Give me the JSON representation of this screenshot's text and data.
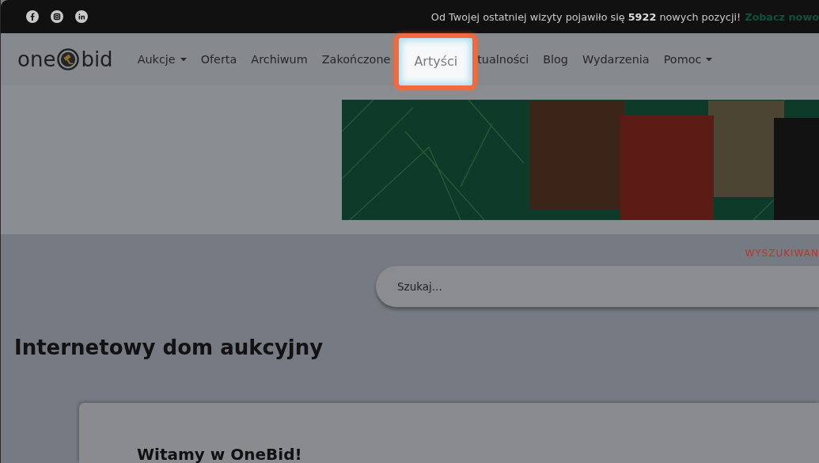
{
  "top_bar": {
    "announcement": "Od Twojej ostatniej wizyty pojawiło się **5922** nowych pozycji!",
    "announcement_link": "Zobacz nowo"
  },
  "logo": {
    "text_left": "one",
    "text_right": "bid"
  },
  "nav": {
    "items": [
      {
        "label": "Aukcje",
        "has_menu": true,
        "highlighted": false
      },
      {
        "label": "Oferta",
        "has_menu": false,
        "highlighted": false
      },
      {
        "label": "Archiwum",
        "has_menu": false,
        "highlighted": false
      },
      {
        "label": "Zakończone",
        "has_menu": false,
        "highlighted": false
      },
      {
        "label": "Artyści",
        "has_menu": false,
        "highlighted": true
      },
      {
        "label": "tualności",
        "has_menu": false,
        "highlighted": false
      },
      {
        "label": "Blog",
        "has_menu": false,
        "highlighted": false
      },
      {
        "label": "Wydarzenia",
        "has_menu": false,
        "highlighted": false
      },
      {
        "label": "Pomoc",
        "has_menu": true,
        "highlighted": false
      }
    ]
  },
  "search": {
    "link": "WYSZUKIWAN",
    "placeholder": "Szukaj..."
  },
  "heading": "Internetowy dom aukcyjny",
  "welcome_card": {
    "title": "Witamy w OneBid!"
  }
}
